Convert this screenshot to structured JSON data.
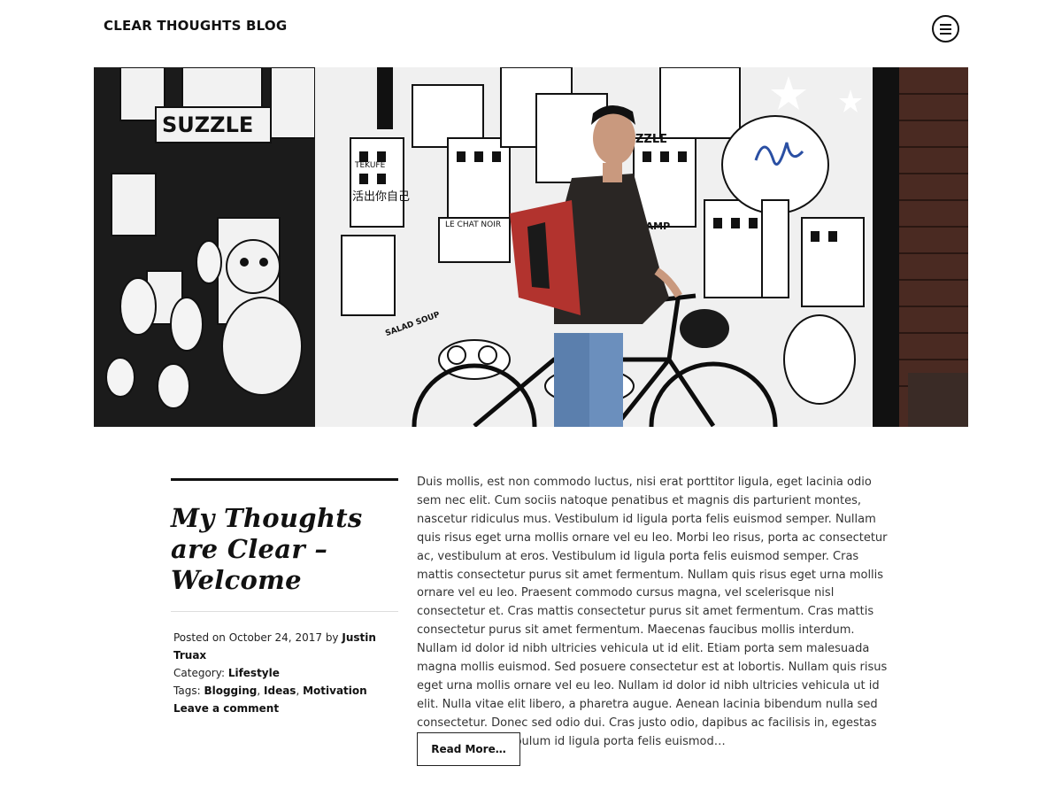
{
  "header": {
    "site_title": "CLEAR THOUGHTS BLOG",
    "menu_icon": "menu-circle-icon"
  },
  "hero_image": {
    "description_icon": "photo-cyclist-mural",
    "sign_text": "SUZZLE",
    "sign_text_2": "ZZLE",
    "shop_text": "LE CHAT NOIR",
    "sign_text_3": "WAMP",
    "sign_text_4": "TEKUFE",
    "cjk_sign": "活出你自己",
    "bottle_text": "SALAD SOUP"
  },
  "post": {
    "title": "My Thoughts are Clear – Welcome",
    "meta": {
      "posted_on_prefix": "Posted on",
      "date": "October 24, 2017",
      "by_prefix": "by",
      "author": "Justin Truax",
      "category_prefix": "Category:",
      "category": "Lifestyle",
      "tags_prefix": "Tags:",
      "tags": [
        "Blogging",
        "Ideas",
        "Motivation"
      ],
      "comment_link": "Leave a comment"
    },
    "excerpt": "Duis mollis, est non commodo luctus, nisi erat porttitor ligula, eget lacinia odio sem nec elit. Cum sociis natoque penatibus et magnis dis parturient montes, nascetur ridiculus mus. Vestibulum id ligula porta felis euismod semper. Nullam quis risus eget urna mollis ornare vel eu leo. Morbi leo risus, porta ac consectetur ac, vestibulum at eros. Vestibulum id ligula porta felis euismod semper. Cras mattis consectetur purus sit amet fermentum. Nullam quis risus eget urna mollis ornare vel eu leo. Praesent commodo cursus magna, vel scelerisque nisl consectetur et. Cras mattis consectetur purus sit amet fermentum. Cras mattis consectetur purus sit amet fermentum. Maecenas faucibus mollis interdum. Nullam id dolor id nibh ultricies vehicula ut id elit. Etiam porta sem malesuada magna mollis euismod. Sed posuere consectetur est at lobortis. Nullam quis risus eget urna mollis ornare vel eu leo. Nullam id dolor id nibh ultricies vehicula ut id elit. Nulla vitae elit libero, a pharetra augue. Aenean lacinia bibendum nulla sed consectetur. Donec sed odio dui. Cras justo odio, dapibus ac facilisis in, egestas eget quam. Vestibulum id ligula porta felis euismod…",
    "read_more_label": "Read More…"
  }
}
